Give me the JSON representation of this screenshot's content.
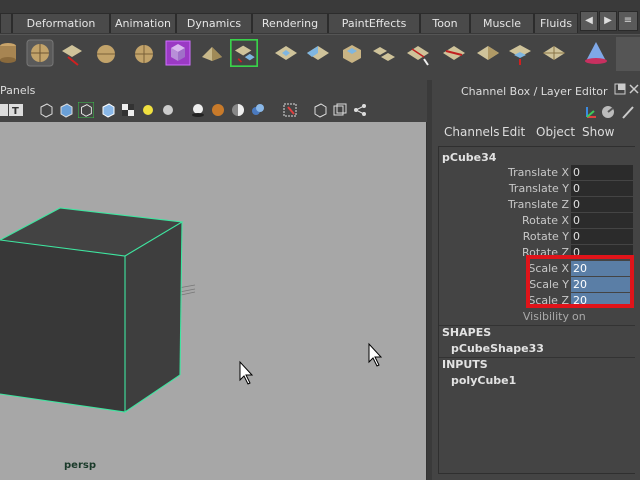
{
  "shelf": {
    "tabs": [
      "Deformation",
      "Animation",
      "Dynamics",
      "Rendering",
      "PaintEffects",
      "Toon",
      "Muscle",
      "Fluids"
    ],
    "arrows": [
      "◀",
      "▶",
      "≡"
    ]
  },
  "panel": {
    "menu_label": "Panels"
  },
  "viewport": {
    "camera_label": "persp"
  },
  "channel_box": {
    "title": "Channel Box / Layer Editor",
    "menu": [
      "Channels",
      "Edit",
      "Object",
      "Show"
    ],
    "object_name": "pCube34",
    "attributes": [
      {
        "label": "Translate X",
        "value": "0"
      },
      {
        "label": "Translate Y",
        "value": "0"
      },
      {
        "label": "Translate Z",
        "value": "0"
      },
      {
        "label": "Rotate X",
        "value": "0"
      },
      {
        "label": "Rotate Y",
        "value": "0"
      },
      {
        "label": "Rotate Z",
        "value": "0"
      },
      {
        "label": "Scale X",
        "value": "20"
      },
      {
        "label": "Scale Y",
        "value": "20"
      },
      {
        "label": "Scale Z",
        "value": "20"
      },
      {
        "label": "Visibility",
        "value": "on"
      }
    ],
    "shapes_header": "SHAPES",
    "shape_name": "pCubeShape33",
    "inputs_header": "INPUTS",
    "input_name": "polyCube1"
  },
  "colors": {
    "highlight_box": "#e0141a",
    "selected_field": "#5a7ea6",
    "viewport_bg": "#a7a7a7",
    "wireframe_highlight": "#3ee6a0"
  }
}
